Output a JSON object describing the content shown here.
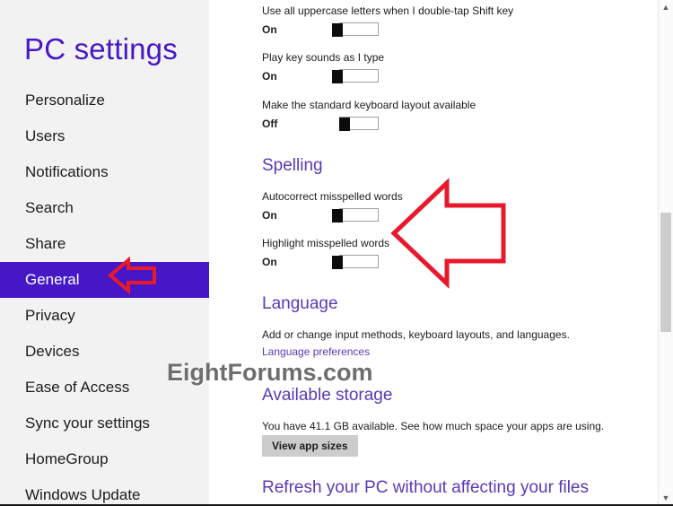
{
  "sidebar": {
    "title": "PC settings",
    "items": [
      {
        "label": "Personalize",
        "selected": false
      },
      {
        "label": "Users",
        "selected": false
      },
      {
        "label": "Notifications",
        "selected": false
      },
      {
        "label": "Search",
        "selected": false
      },
      {
        "label": "Share",
        "selected": false
      },
      {
        "label": "General",
        "selected": true
      },
      {
        "label": "Privacy",
        "selected": false
      },
      {
        "label": "Devices",
        "selected": false
      },
      {
        "label": "Ease of Access",
        "selected": false
      },
      {
        "label": "Sync your settings",
        "selected": false
      },
      {
        "label": "HomeGroup",
        "selected": false
      },
      {
        "label": "Windows Update",
        "selected": false
      }
    ]
  },
  "content": {
    "keyboard_settings": [
      {
        "label": "Use all uppercase letters when I double-tap Shift key",
        "state": "On",
        "on": true
      },
      {
        "label": "Play key sounds as I type",
        "state": "On",
        "on": true
      },
      {
        "label": "Make the standard keyboard layout available",
        "state": "Off",
        "on": false
      }
    ],
    "spelling": {
      "heading": "Spelling",
      "settings": [
        {
          "label": "Autocorrect misspelled words",
          "state": "On",
          "on": true
        },
        {
          "label": "Highlight misspelled words",
          "state": "On",
          "on": true
        }
      ]
    },
    "language": {
      "heading": "Language",
      "description": "Add or change input methods, keyboard layouts, and languages.",
      "link": "Language preferences"
    },
    "available_storage": {
      "heading": "Available storage",
      "description": "You have 41.1 GB available. See how much space your apps are using.",
      "button": "View app sizes"
    },
    "refresh": {
      "heading": "Refresh your PC without affecting your files"
    }
  },
  "watermark": "EightForums.com",
  "annotations": {
    "arrow_general_direction": "left",
    "arrow_spelling_direction": "left",
    "arrow_color": "#e8192c"
  },
  "scrollbar": {
    "up_glyph": "▲",
    "down_glyph": "▼"
  },
  "colors": {
    "accent": "#4617c6",
    "heading": "#5b38b8",
    "sidebar_bg": "#f2f2f2",
    "annotation_red": "#e8192c"
  }
}
